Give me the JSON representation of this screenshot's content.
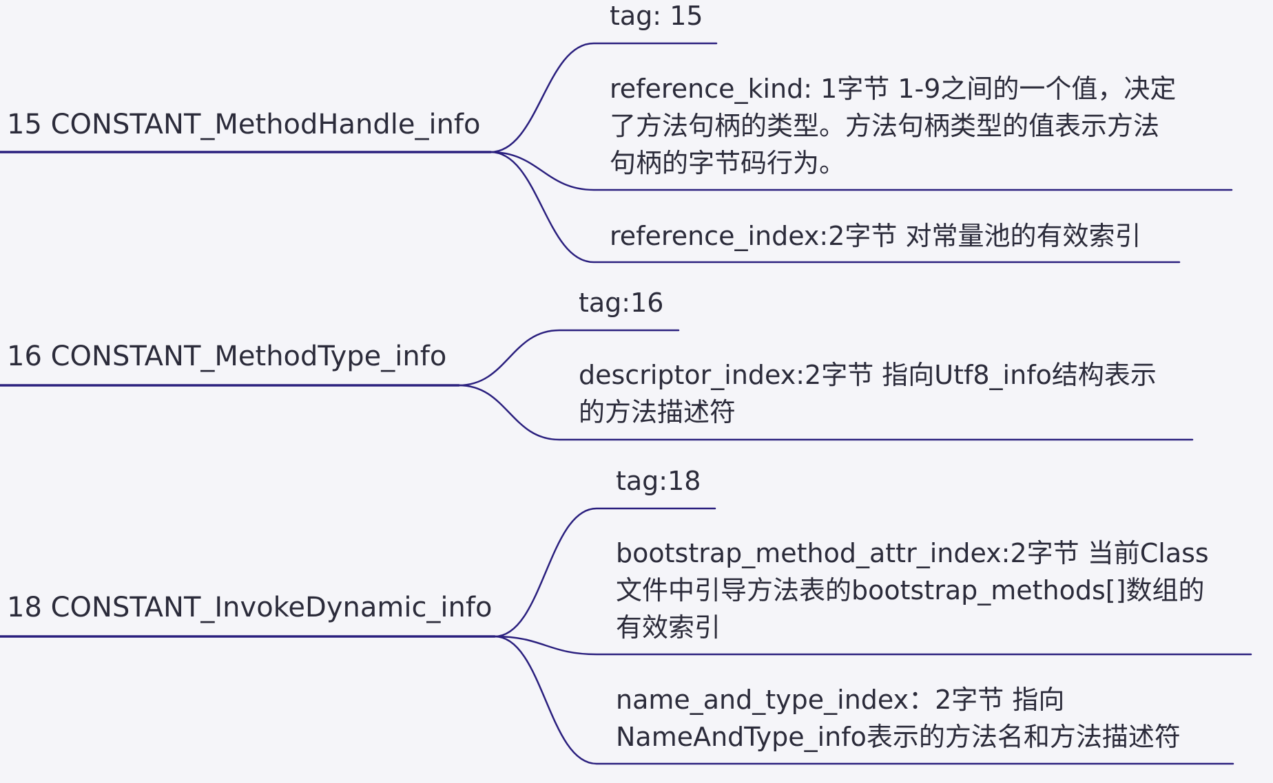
{
  "colors": {
    "background": "#f5f5f9",
    "connector": "#2a1f7e",
    "text": "#2b2b3a"
  },
  "nodes": {
    "n15": {
      "title": "15 CONSTANT_MethodHandle_info",
      "children": [
        {
          "lines": [
            "tag: 15"
          ]
        },
        {
          "lines": [
            "reference_kind: 1字节 1-9之间的一个值，决定",
            "了方法句柄的类型。方法句柄类型的值表示方法",
            "句柄的字节码行为。"
          ]
        },
        {
          "lines": [
            "reference_index:2字节 对常量池的有效索引"
          ]
        }
      ]
    },
    "n16": {
      "title": "16 CONSTANT_MethodType_info",
      "children": [
        {
          "lines": [
            "tag:16"
          ]
        },
        {
          "lines": [
            "descriptor_index:2字节 指向Utf8_info结构表示",
            "的方法描述符"
          ]
        }
      ]
    },
    "n18": {
      "title": "18 CONSTANT_InvokeDynamic_info",
      "children": [
        {
          "lines": [
            "tag:18"
          ]
        },
        {
          "lines": [
            "bootstrap_method_attr_index:2字节 当前Class",
            "文件中引导方法表的bootstrap_methods[]数组的",
            "有效索引"
          ]
        },
        {
          "lines": [
            "name_and_type_index：2字节 指向",
            "NameAndType_info表示的方法名和方法描述符"
          ]
        }
      ]
    }
  }
}
